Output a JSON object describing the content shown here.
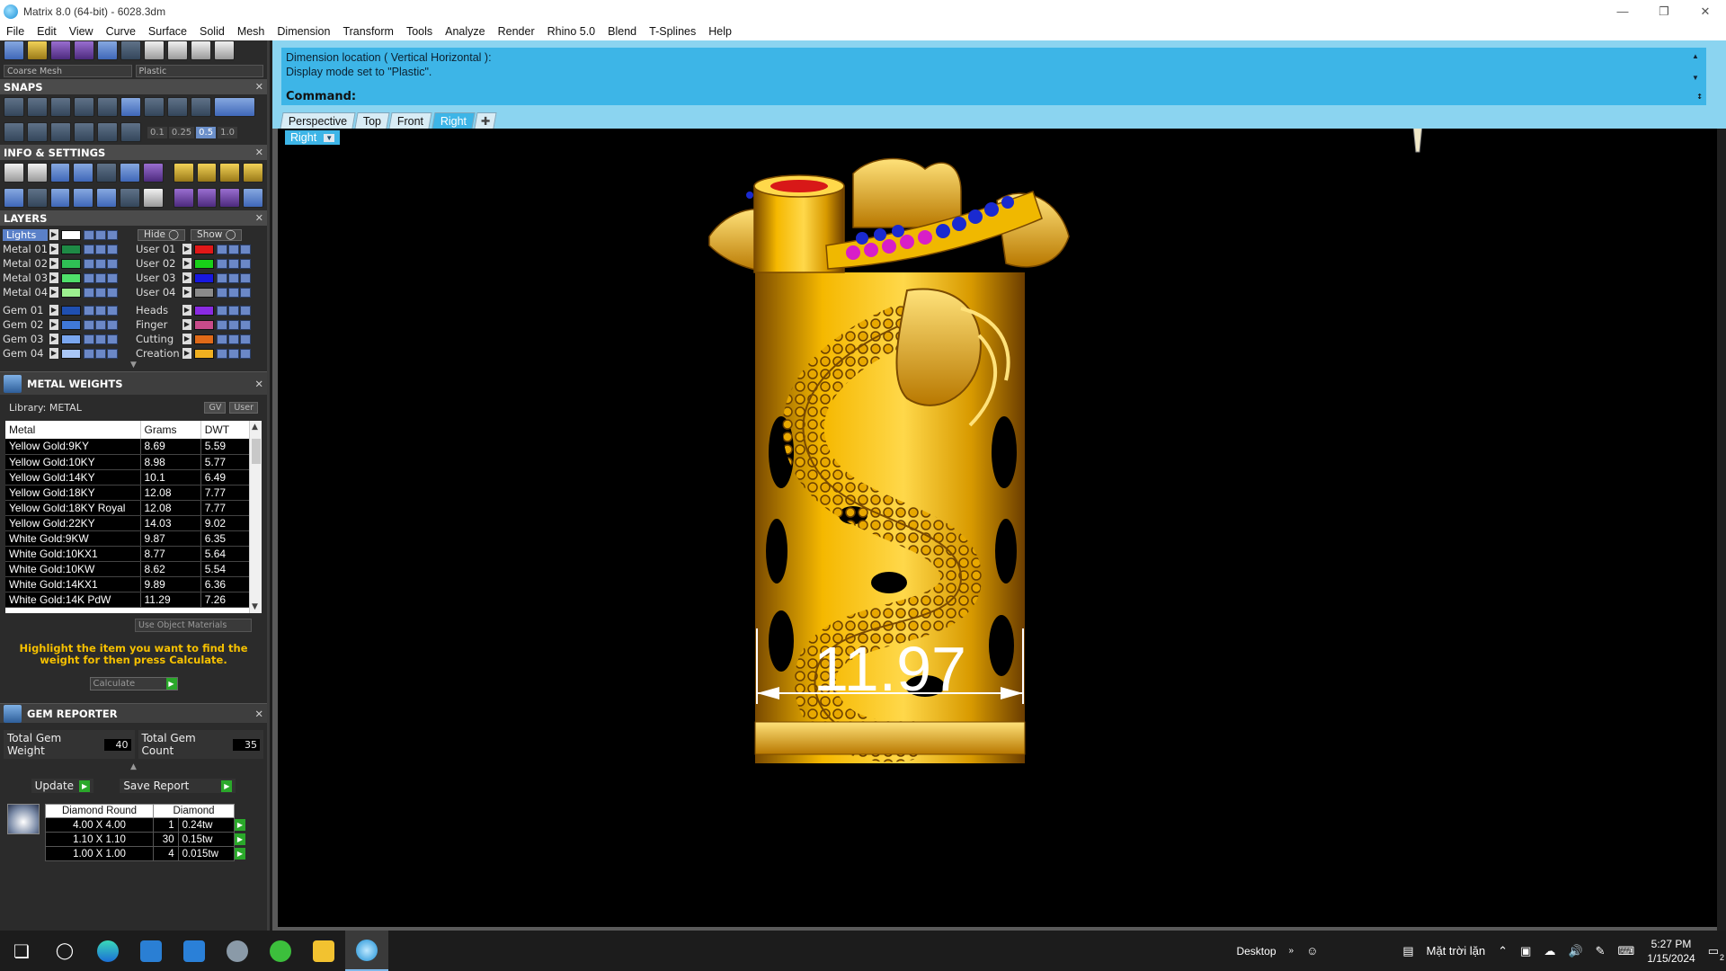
{
  "window": {
    "title": "Matrix 8.0 (64-bit) - 6028.3dm"
  },
  "menu": [
    "File",
    "Edit",
    "View",
    "Curve",
    "Surface",
    "Solid",
    "Mesh",
    "Dimension",
    "Transform",
    "Tools",
    "Analyze",
    "Render",
    "Rhino 5.0",
    "Blend",
    "T-Splines",
    "Help"
  ],
  "toolbar": {
    "mesh_select": "Coarse Mesh",
    "material_select": "Plastic"
  },
  "snaps": {
    "title": "SNAPS",
    "values": [
      "0.1",
      "0.25",
      "0.5",
      "1.0"
    ],
    "active_value": "0.5"
  },
  "info": {
    "title": "INFO & SETTINGS"
  },
  "layers": {
    "title": "LAYERS",
    "lights_label": "Lights",
    "hide_label": "Hide",
    "show_label": "Show",
    "left": [
      {
        "name": "Metal 01",
        "color": "#1e8a45"
      },
      {
        "name": "Metal 02",
        "color": "#2fbf55"
      },
      {
        "name": "Metal 03",
        "color": "#4fe06a"
      },
      {
        "name": "Metal 04",
        "color": "#9df08f"
      },
      {
        "name": "Gem 01",
        "color": "#1f4fb0"
      },
      {
        "name": "Gem 02",
        "color": "#3f78d8"
      },
      {
        "name": "Gem 03",
        "color": "#7aa6ee"
      },
      {
        "name": "Gem 04",
        "color": "#a9c6f5"
      }
    ],
    "right": [
      {
        "name": "User 01",
        "color": "#e01818"
      },
      {
        "name": "User 02",
        "color": "#18d018"
      },
      {
        "name": "User 03",
        "color": "#1818e0"
      },
      {
        "name": "User 04",
        "color": "#8a8a8a"
      },
      {
        "name": "Heads",
        "color": "#8a2be2"
      },
      {
        "name": "Finger",
        "color": "#c84b8a"
      },
      {
        "name": "Cutting",
        "color": "#e06a18"
      },
      {
        "name": "Creation",
        "color": "#f0b020"
      }
    ]
  },
  "metal_weights": {
    "title": "METAL WEIGHTS",
    "library_label": "Library: METAL",
    "btn_gv": "GV",
    "btn_user": "User",
    "columns": [
      "Metal",
      "Grams",
      "DWT"
    ],
    "rows": [
      [
        "Yellow Gold:9KY",
        "8.69",
        "5.59"
      ],
      [
        "Yellow Gold:10KY",
        "8.98",
        "5.77"
      ],
      [
        "Yellow Gold:14KY",
        "10.1",
        "6.49"
      ],
      [
        "Yellow Gold:18KY",
        "12.08",
        "7.77"
      ],
      [
        "Yellow Gold:18KY Royal",
        "12.08",
        "7.77"
      ],
      [
        "Yellow Gold:22KY",
        "14.03",
        "9.02"
      ],
      [
        "White Gold:9KW",
        "9.87",
        "6.35"
      ],
      [
        "White Gold:10KX1",
        "8.77",
        "5.64"
      ],
      [
        "White Gold:10KW",
        "8.62",
        "5.54"
      ],
      [
        "White Gold:14KX1",
        "9.89",
        "6.36"
      ],
      [
        "White Gold:14K PdW",
        "11.29",
        "7.26"
      ]
    ],
    "use_object_materials": "Use Object Materials",
    "hint": "Highlight the item you want to find the weight for then press Calculate.",
    "calculate_label": "Calculate"
  },
  "gem_reporter": {
    "title": "GEM REPORTER",
    "total_weight_label": "Total Gem Weight",
    "total_weight_value": "40",
    "total_count_label": "Total Gem Count",
    "total_count_value": "35",
    "update_label": "Update",
    "save_label": "Save Report",
    "columns": [
      "Diamond Round",
      "Diamond"
    ],
    "rows": [
      [
        "4.00 X 4.00",
        "1",
        "0.24tw"
      ],
      [
        "1.10 X 1.10",
        "30",
        "0.15tw"
      ],
      [
        "1.00 X 1.00",
        "4",
        "0.015tw"
      ]
    ]
  },
  "command": {
    "history_line1": "Dimension location ( Vertical  Horizontal ):",
    "history_line2": "Display mode set to \"Plastic\".",
    "prompt": "Command:"
  },
  "viewport_tabs": [
    "Perspective",
    "Top",
    "Front",
    "Right"
  ],
  "active_tab": "Right",
  "viewport": {
    "label": "Right",
    "dimension": "11.97"
  },
  "taskbar": {
    "desktop_label": "Desktop",
    "weather_label": "Mặt trời lặn",
    "time": "5:27 PM",
    "date": "1/15/2024",
    "notifications": "2"
  }
}
